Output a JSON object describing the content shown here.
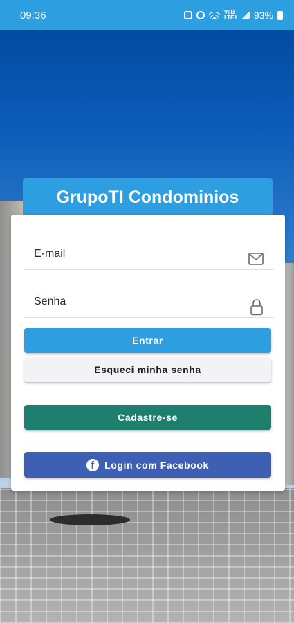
{
  "status_bar": {
    "time": "09:36",
    "battery": "93%",
    "network_top": "VoB",
    "network_bottom": "LTE1"
  },
  "app": {
    "title": "GrupoTI Condominios"
  },
  "form": {
    "email_label": "E-mail",
    "password_label": "Senha"
  },
  "buttons": {
    "login": "Entrar",
    "forgot": "Esqueci minha senha",
    "register": "Cadastre-se",
    "facebook": "Login com Facebook"
  },
  "icons": {
    "email": "envelope-icon",
    "password": "lock-icon",
    "facebook": "facebook-icon"
  },
  "colors": {
    "primary": "#2d9ee0",
    "register": "#1f7f6e",
    "facebook": "#3e60b4"
  }
}
